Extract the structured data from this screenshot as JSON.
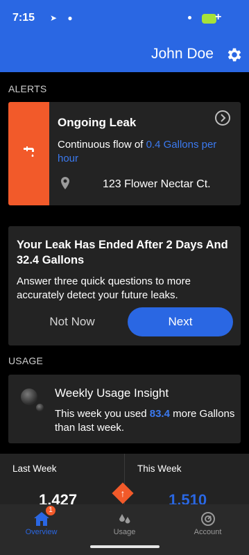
{
  "status_bar": {
    "time": "7:15"
  },
  "header": {
    "user_name": "John Doe"
  },
  "alerts_section": {
    "label": "ALERTS"
  },
  "alert": {
    "title": "Ongoing Leak",
    "body_prefix": "Continuous flow of ",
    "body_highlight": "0.4 Gallons per hour",
    "address": "123 Flower Nectar Ct."
  },
  "leak_ended": {
    "title": "Your Leak Has Ended After 2 Days And 32.4 Gallons",
    "body": "Answer three quick questions to more accurately detect your future leaks.",
    "not_now_label": "Not Now",
    "next_label": "Next"
  },
  "usage_section": {
    "label": "USAGE"
  },
  "insight": {
    "title": "Weekly Usage Insight",
    "body_prefix": "This week you used ",
    "body_highlight": "83.4",
    "body_suffix": " more Gallons than last week."
  },
  "comparison": {
    "last_week_label": "Last Week",
    "last_week_value": "1,427",
    "this_week_label": "This Week",
    "this_week_value": "1,510"
  },
  "tabbar": {
    "tabs": [
      {
        "label": "Overview",
        "badge": "1",
        "active": true
      },
      {
        "label": "Usage"
      },
      {
        "label": "Account"
      }
    ]
  },
  "colors": {
    "header_blue": "#2a67e3",
    "alert_orange": "#f25a2a",
    "card_bg": "#232323"
  }
}
